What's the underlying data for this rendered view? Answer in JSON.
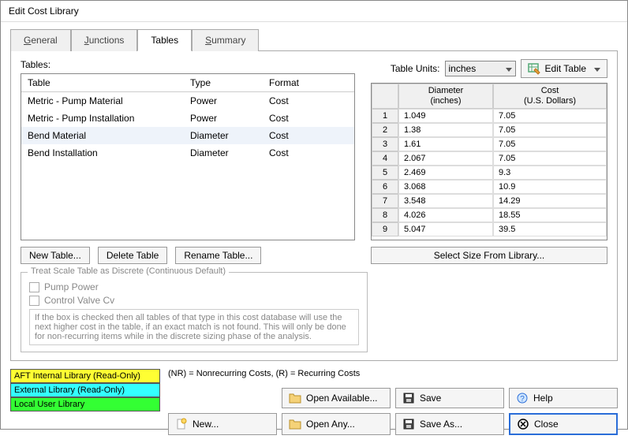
{
  "window": {
    "title": "Edit Cost Library"
  },
  "tabs": {
    "general": "General",
    "junctions": "Junctions",
    "tables": "Tables",
    "summary": "Summary"
  },
  "left": {
    "label": "Tables:",
    "headers": {
      "name": "Table",
      "type": "Type",
      "format": "Format"
    },
    "rows": [
      {
        "name": "Metric - Pump Material",
        "type": "Power",
        "format": "Cost",
        "selected": false
      },
      {
        "name": "Metric - Pump Installation",
        "type": "Power",
        "format": "Cost",
        "selected": false
      },
      {
        "name": "Bend Material",
        "type": "Diameter",
        "format": "Cost",
        "selected": true
      },
      {
        "name": "Bend Installation",
        "type": "Diameter",
        "format": "Cost",
        "selected": false
      }
    ],
    "buttons": {
      "new": "New Table...",
      "delete": "Delete Table",
      "rename": "Rename Table..."
    }
  },
  "right": {
    "units_label": "Table Units:",
    "units_value": "inches",
    "edit_table": "Edit Table",
    "headers": {
      "index": "",
      "diameter": "Diameter\n(inches)",
      "cost": "Cost\n(U.S. Dollars)"
    },
    "rows": [
      {
        "diameter": "1.049",
        "cost": "7.05"
      },
      {
        "diameter": "1.38",
        "cost": "7.05"
      },
      {
        "diameter": "1.61",
        "cost": "7.05"
      },
      {
        "diameter": "2.067",
        "cost": "7.05"
      },
      {
        "diameter": "2.469",
        "cost": "9.3"
      },
      {
        "diameter": "3.068",
        "cost": "10.9"
      },
      {
        "diameter": "3.548",
        "cost": "14.29"
      },
      {
        "diameter": "4.026",
        "cost": "18.55"
      },
      {
        "diameter": "5.047",
        "cost": "39.5"
      }
    ],
    "select_size": "Select Size From Library..."
  },
  "discrete": {
    "legend": "Treat Scale Table as Discrete (Continuous Default)",
    "opt1": "Pump Power",
    "opt2": "Control Valve Cv",
    "note": "If the box is checked then all tables of that type in this cost database will use the next higher cost in the table, if an exact match is not found. This will only be done for non-recurring items while in the discrete sizing phase of the analysis."
  },
  "footer": {
    "lib": {
      "aft": "AFT Internal Library (Read-Only)",
      "ext": "External Library (Read-Only)",
      "local": "Local User Library"
    },
    "cost_note": "(NR) = Nonrecurring Costs, (R) = Recurring Costs",
    "buttons": {
      "new": "New...",
      "open_available": "Open Available...",
      "open_any": "Open Any...",
      "save": "Save",
      "save_as": "Save As...",
      "help": "Help",
      "close": "Close"
    }
  }
}
